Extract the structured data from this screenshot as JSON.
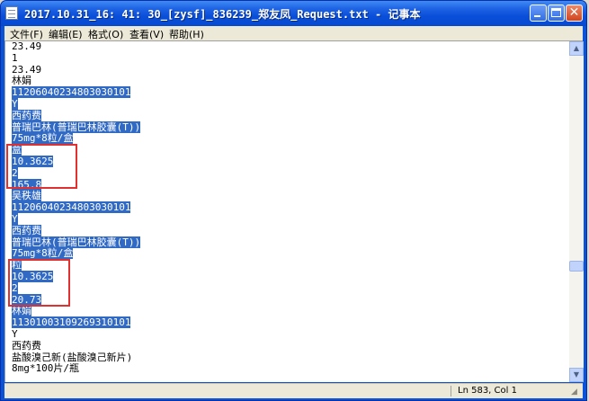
{
  "window": {
    "title": "2017.10.31_16: 41: 30_[zysf]_836239_郑友凤_Request.txt - 记事本"
  },
  "menubar": {
    "items": [
      "文件(F)",
      "编辑(E)",
      "格式(O)",
      "查看(V)",
      "帮助(H)"
    ]
  },
  "document": {
    "lines": [
      {
        "text": "23.49",
        "selected": false
      },
      {
        "text": "1",
        "selected": false
      },
      {
        "text": "23.49",
        "selected": false
      },
      {
        "text": "林娟",
        "selected": false
      },
      {
        "text": "11206040234803030101",
        "selected": true
      },
      {
        "text": "Y",
        "selected": true
      },
      {
        "text": "西药费",
        "selected": true
      },
      {
        "text": "普瑞巴林(普瑞巴林胶囊(T))",
        "selected": true
      },
      {
        "text": "75mg*8粒/盒",
        "selected": true
      },
      {
        "text": "盒",
        "selected": true
      },
      {
        "text": "10.3625",
        "selected": true
      },
      {
        "text": "2",
        "selected": true
      },
      {
        "text": "165.8",
        "selected": true
      },
      {
        "text": "吴秩雄",
        "selected": true
      },
      {
        "text": "11206040234803030101",
        "selected": true
      },
      {
        "text": "Y",
        "selected": true
      },
      {
        "text": "西药费",
        "selected": true
      },
      {
        "text": "普瑞巴林(普瑞巴林胶囊(T))",
        "selected": true
      },
      {
        "text": "75mg*8粒/盒",
        "selected": true
      },
      {
        "text": "粒",
        "selected": true
      },
      {
        "text": "10.3625",
        "selected": true
      },
      {
        "text": "2",
        "selected": true
      },
      {
        "text": "20.73",
        "selected": true
      },
      {
        "text": "林娟",
        "selected": true
      },
      {
        "text": "11301003109269310101",
        "selected": true
      },
      {
        "text": "Y",
        "selected": false
      },
      {
        "text": "西药费",
        "selected": false
      },
      {
        "text": "盐酸溴己新(盐酸溴己新片)",
        "selected": false
      },
      {
        "text": "8mg*100片/瓶",
        "selected": false
      }
    ]
  },
  "statusbar": {
    "position": "Ln 583, Col 1"
  },
  "colors": {
    "selection": "#316ac5",
    "annotation": "#e03030",
    "titlebar": "#0a53d8"
  },
  "icons": {
    "app": "notepad-icon",
    "minimize": "minimize-icon",
    "maximize": "maximize-icon",
    "close": "close-icon"
  }
}
